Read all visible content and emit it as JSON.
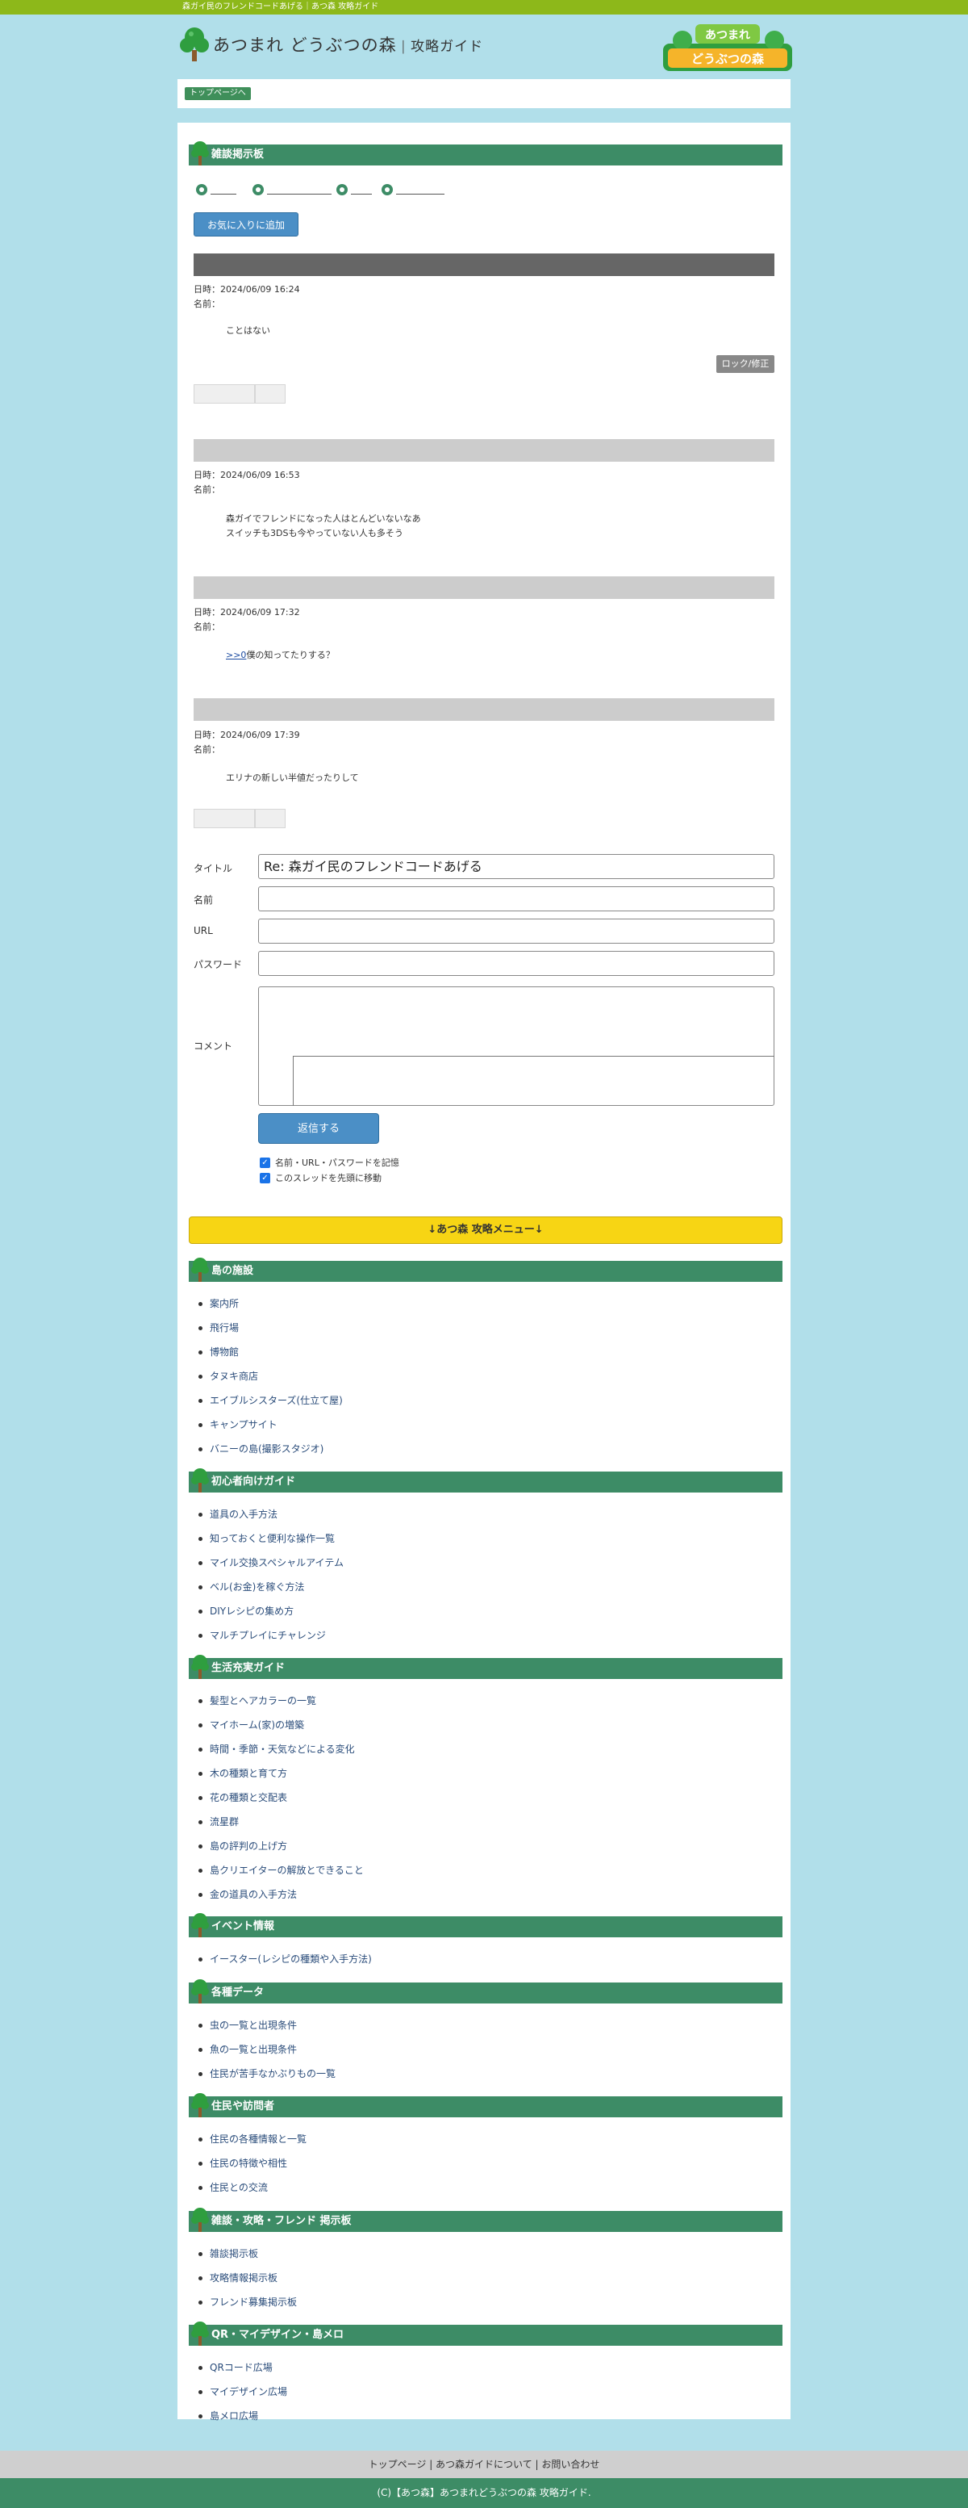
{
  "topbar_text": "森ガイ民のフレンドコードあげる｜あつ森 攻略ガイド",
  "site": {
    "title_main": "あつまれ どうぶつの森",
    "title_sub": "攻略ガイド",
    "right_logo_line1": "あつまれ",
    "right_logo_line2": "どうぶつの森"
  },
  "breadcrumb": {
    "top_label": "トップページへ"
  },
  "board": {
    "heading": "雑談掲示板",
    "favorite_label": "お気に入りに追加",
    "posts": [
      {
        "meta_date": "日時：2024/06/09 16:24",
        "meta_name": "名前：",
        "body_lines": [
          "ことはない"
        ],
        "bar_color": "#666666"
      },
      {
        "meta_date": "日時：2024/06/09 16:53",
        "meta_name": "名前：",
        "body_lines": [
          "森ガイでフレンドになった人はとんどいないなあ",
          "スイッチも3DSも今やっていない人も多そう"
        ],
        "bar_color": "#cccccc"
      },
      {
        "meta_date": "日時：2024/06/09 17:32",
        "meta_name": "名前：",
        "body_link": ">>0",
        "body_lines": [
          "僕の知ってたりする？"
        ],
        "bar_color": "#cccccc"
      },
      {
        "meta_date": "日時：2024/06/09 17:39",
        "meta_name": "名前：",
        "body_lines": [
          "エリナの新しい半値だったりして"
        ],
        "bar_color": "#cccccc"
      }
    ],
    "lock_label": "ロック/修正"
  },
  "form": {
    "title_label": "タイトル",
    "title_value": "Re: 森ガイ民のフレンドコードあげる",
    "name_label": "名前",
    "url_label": "URL",
    "password_label": "パスワード",
    "comment_label": "コメント",
    "submit_label": "返信する",
    "remember_label": "名前・URL・パスワードを記憶",
    "top_label": "このスレッドを先頭に移動"
  },
  "menu_banner": "↓あつ森 攻略メニュー↓",
  "menu_sections": [
    {
      "heading": "島の施設",
      "items": [
        "案内所",
        "飛行場",
        "博物館",
        "タヌキ商店",
        "エイブルシスターズ(仕立て屋)",
        "キャンプサイト",
        "バニーの島(撮影スタジオ)"
      ]
    },
    {
      "heading": "初心者向けガイド",
      "items": [
        "道具の入手方法",
        "知っておくと便利な操作一覧",
        "マイル交換スペシャルアイテム",
        "ベル(お金)を稼ぐ方法",
        "DIYレシピの集め方",
        "マルチプレイにチャレンジ"
      ]
    },
    {
      "heading": "生活充実ガイド",
      "items": [
        "髪型とヘアカラーの一覧",
        "マイホーム(家)の増築",
        "時間・季節・天気などによる変化",
        "木の種類と育て方",
        "花の種類と交配表",
        "流星群",
        "島の評判の上げ方",
        "島クリエイターの解放とできること",
        "金の道具の入手方法"
      ]
    },
    {
      "heading": "イベント情報",
      "items": [
        "イースター(レシピの種類や入手方法)"
      ]
    },
    {
      "heading": "各種データ",
      "items": [
        "虫の一覧と出現条件",
        "魚の一覧と出現条件",
        "住民が苦手なかぶりもの一覧"
      ]
    },
    {
      "heading": "住民や訪問者",
      "items": [
        "住民の各種情報と一覧",
        "住民の特徴や相性",
        "住民との交流"
      ]
    },
    {
      "heading": "雑談・攻略・フレンド 掲示板",
      "items": [
        "雑談掲示板",
        "攻略情報掲示板",
        "フレンド募集掲示板"
      ]
    },
    {
      "heading": "QR・マイデザイン・島メロ",
      "items": [
        "QRコード広場",
        "マイデザイン広場",
        "島メロ広場"
      ]
    }
  ],
  "footer": {
    "links": "トップページ | あつ森ガイドについて | お問い合わせ",
    "copyright": "(C)【あつ森】あつまれどうぶつの森 攻略ガイド."
  },
  "colors": {
    "brand_green": "#3d8c66",
    "top_bar": "#8db81a",
    "background": "#b1dfea",
    "accent_blue": "#4b8fc6",
    "menu_yellow": "#f7d514"
  }
}
